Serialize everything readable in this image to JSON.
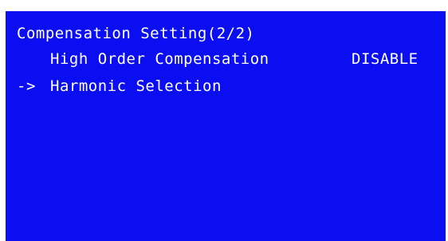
{
  "screen": {
    "title": "Compensation Setting(2/2)",
    "colors": {
      "background": "#0b0ef0",
      "text": "#ffffff"
    },
    "items": [
      {
        "label": "High Order Compensation",
        "value": "DISABLE",
        "selected": false
      },
      {
        "label": "Harmonic Selection",
        "selected": true
      }
    ],
    "cursor": "->"
  }
}
